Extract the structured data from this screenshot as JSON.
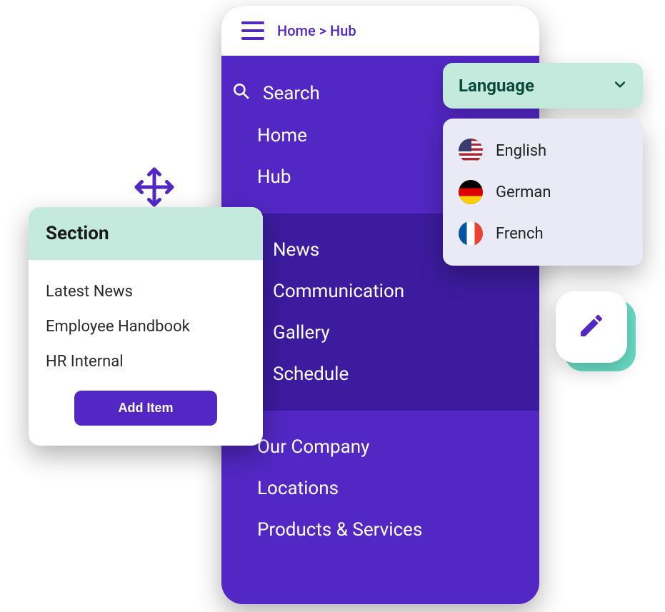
{
  "colors": {
    "primary": "#5227C4",
    "primary_dark": "#3C1B9E",
    "mint": "#C4EADE"
  },
  "breadcrumb": {
    "home": "Home",
    "sep": ">",
    "current": "Hub"
  },
  "nav": {
    "search": "Search",
    "top": [
      "Home",
      "Hub"
    ],
    "sub": [
      "News",
      "Communication",
      "Gallery",
      "Schedule"
    ],
    "bottom": [
      "Our Company",
      "Locations",
      "Products & Services"
    ]
  },
  "section": {
    "title": "Section",
    "items": [
      "Latest News",
      "Employee Handbook",
      "HR Internal"
    ],
    "add_label": "Add Item"
  },
  "language": {
    "label": "Language",
    "options": [
      {
        "label": "English",
        "flag": "us"
      },
      {
        "label": "German",
        "flag": "de"
      },
      {
        "label": "French",
        "flag": "fr"
      }
    ]
  },
  "icons": {
    "hamburger": "hamburger-icon",
    "search": "search-icon",
    "chevron": "chevron-down-icon",
    "move": "move-icon",
    "edit": "pencil-icon"
  }
}
